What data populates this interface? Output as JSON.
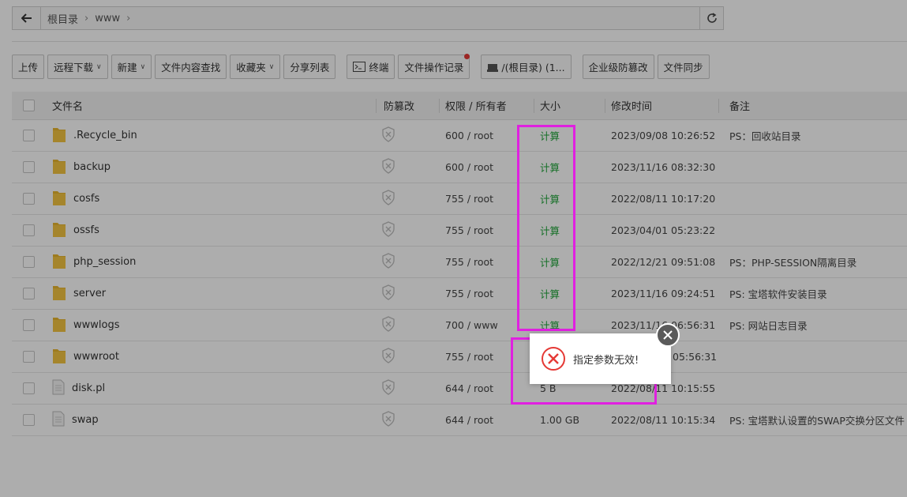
{
  "pathbar": {
    "crumbs": [
      "根目录",
      "www"
    ]
  },
  "toolbar": {
    "upload": "上传",
    "remote_download": "远程下载",
    "new": "新建",
    "content_search": "文件内容查找",
    "favorites": "收藏夹",
    "share_list": "分享列表",
    "terminal": "终端",
    "op_log": "文件操作记录",
    "disk": "/(根目录) (1...",
    "tamper_enterprise": "企业级防篡改",
    "file_sync": "文件同步"
  },
  "table": {
    "headers": {
      "name": "文件名",
      "protect": "防篡改",
      "perm": "权限 / 所有者",
      "size": "大小",
      "mtime": "修改时间",
      "note": "备注"
    },
    "rows": [
      {
        "name": ".Recycle_bin",
        "type": "folder",
        "perm": "600 / root",
        "size": "计算",
        "mtime": "2023/09/08 10:26:52",
        "note": "PS：回收站目录"
      },
      {
        "name": "backup",
        "type": "folder",
        "perm": "600 / root",
        "size": "计算",
        "mtime": "2023/11/16 08:32:30",
        "note": ""
      },
      {
        "name": "cosfs",
        "type": "folder",
        "perm": "755 / root",
        "size": "计算",
        "mtime": "2022/08/11 10:17:20",
        "note": ""
      },
      {
        "name": "ossfs",
        "type": "folder",
        "perm": "755 / root",
        "size": "计算",
        "mtime": "2023/04/01 05:23:22",
        "note": ""
      },
      {
        "name": "php_session",
        "type": "folder",
        "perm": "755 / root",
        "size": "计算",
        "mtime": "2022/12/21 09:51:08",
        "note": "PS：PHP-SESSION隔离目录"
      },
      {
        "name": "server",
        "type": "folder",
        "perm": "755 / root",
        "size": "计算",
        "mtime": "2023/11/16 09:24:51",
        "note": "PS: 宝塔软件安装目录"
      },
      {
        "name": "wwwlogs",
        "type": "folder",
        "perm": "700 / www",
        "size": "计算",
        "mtime": "2023/11/16 06:56:31",
        "note": "PS: 网站日志目录"
      },
      {
        "name": "wwwroot",
        "type": "folder",
        "perm": "755 / root",
        "size": "",
        "mtime": "05:56:31",
        "note": ""
      },
      {
        "name": "disk.pl",
        "type": "file",
        "perm": "644 / root",
        "size": "5 B",
        "mtime": "2022/08/11 10:15:55",
        "note": ""
      },
      {
        "name": "swap",
        "type": "file",
        "perm": "644 / root",
        "size": "1.00 GB",
        "mtime": "2022/08/11 10:15:34",
        "note": "PS: 宝塔默认设置的SWAP交换分区文件"
      }
    ]
  },
  "toast": {
    "message": "指定参数无效!"
  },
  "colors": {
    "accent_green": "#20a53a",
    "highlight": "#e020e0",
    "error_red": "#e53935"
  }
}
